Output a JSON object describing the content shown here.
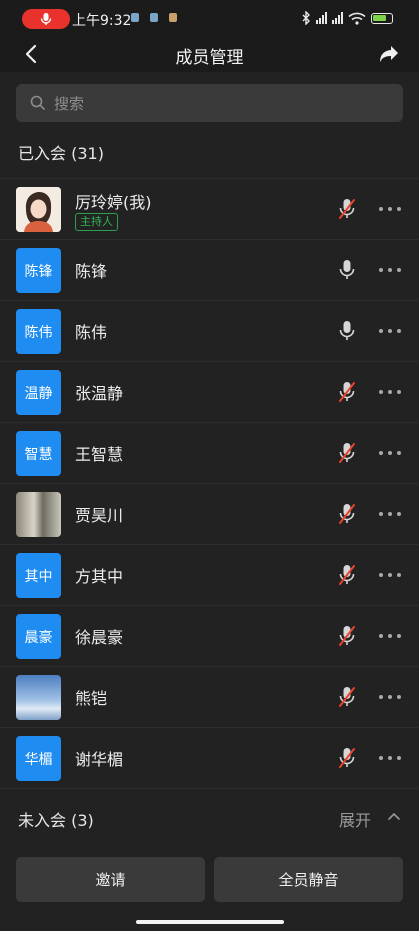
{
  "status_bar": {
    "time": "上午9:32",
    "recording_color": "#e8322b",
    "battery_color": "#7dd34a",
    "icons": [
      "recording-mic-icon",
      "app-notification-icon",
      "bluetooth-icon",
      "cellular-signal-icon",
      "wifi-icon",
      "battery-icon"
    ]
  },
  "nav": {
    "title": "成员管理",
    "back_icon": "chevron-left-icon",
    "share_icon": "share-icon"
  },
  "search": {
    "placeholder": "搜索",
    "icon": "search-icon"
  },
  "joined": {
    "label": "已入会 (31)"
  },
  "members": [
    {
      "name": "厉玲婷(我)",
      "avatar_type": "photo-girl",
      "avatar_text": "",
      "host_label": "主持人",
      "mic": "muted"
    },
    {
      "name": "陈锋",
      "avatar_type": "text",
      "avatar_text": "陈锋",
      "host_label": "",
      "mic": "on"
    },
    {
      "name": "陈伟",
      "avatar_type": "text",
      "avatar_text": "陈伟",
      "host_label": "",
      "mic": "on"
    },
    {
      "name": "张温静",
      "avatar_type": "text",
      "avatar_text": "温静",
      "host_label": "",
      "mic": "muted"
    },
    {
      "name": "王智慧",
      "avatar_type": "text",
      "avatar_text": "智慧",
      "host_label": "",
      "mic": "muted"
    },
    {
      "name": "贾昊川",
      "avatar_type": "photo-cliff",
      "avatar_text": "",
      "host_label": "",
      "mic": "muted"
    },
    {
      "name": "方其中",
      "avatar_type": "text",
      "avatar_text": "其中",
      "host_label": "",
      "mic": "muted"
    },
    {
      "name": "徐晨豪",
      "avatar_type": "text",
      "avatar_text": "晨豪",
      "host_label": "",
      "mic": "muted"
    },
    {
      "name": "熊铠",
      "avatar_type": "photo-sky",
      "avatar_text": "",
      "host_label": "",
      "mic": "muted"
    },
    {
      "name": "谢华楣",
      "avatar_type": "text",
      "avatar_text": "华楣",
      "host_label": "",
      "mic": "muted"
    }
  ],
  "not_joined": {
    "label": "未入会 (3)",
    "expand_label": "展开"
  },
  "buttons": {
    "invite": "邀请",
    "mute_all": "全员静音"
  },
  "colors": {
    "background": "#222222",
    "avatar_blue": "#1e8cf0",
    "host_green": "#35b35a",
    "muted_slash": "#e8432f"
  }
}
